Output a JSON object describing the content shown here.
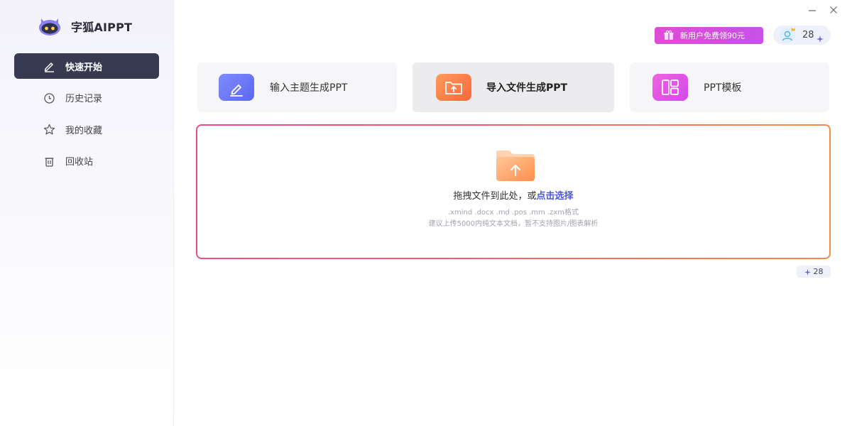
{
  "app": {
    "name": "字狐AIPPT"
  },
  "sidebar": {
    "items": [
      {
        "label": "快速开始",
        "icon": "pen-icon",
        "active": true
      },
      {
        "label": "历史记录",
        "icon": "clock-icon",
        "active": false
      },
      {
        "label": "我的收藏",
        "icon": "star-icon",
        "active": false
      },
      {
        "label": "回收站",
        "icon": "trash-icon",
        "active": false
      }
    ]
  },
  "header": {
    "promo_label": "新用户免费领90元",
    "credits": "28"
  },
  "cards": [
    {
      "label": "输入主题生成PPT",
      "icon": "edit-icon",
      "selected": false
    },
    {
      "label": "导入文件生成PPT",
      "icon": "folder-upload-icon",
      "selected": true
    },
    {
      "label": "PPT模板",
      "icon": "layout-template-icon",
      "selected": false
    }
  ],
  "upload": {
    "prompt": "拖拽文件到此处，或",
    "link": "点击选择",
    "formats": ".xmind .docx .md .pos .mm .zxm格式",
    "note": "建议上传5000内纯文本文档，暂不支持图片/图表解析"
  },
  "cost": "28",
  "colors": {
    "sidebar_active": "#383a52",
    "accent_link": "#4a55e6",
    "promo": "#d04ae8",
    "drop_border_start": "#ee4d80",
    "drop_border_end": "#f78a44"
  }
}
